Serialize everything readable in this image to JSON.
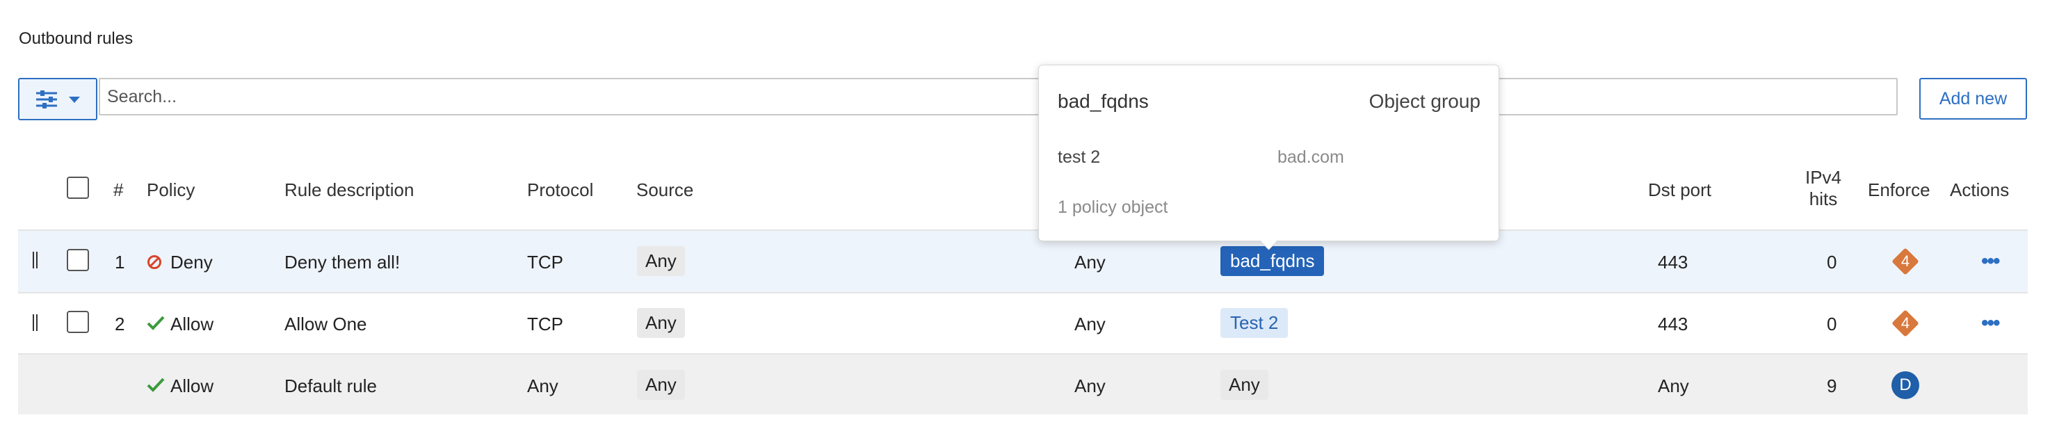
{
  "section_title": "Outbound rules",
  "toolbar": {
    "filter_icon": "sliders-icon",
    "search_placeholder": "Search...",
    "add_new_label": "Add new"
  },
  "table": {
    "headers": {
      "number": "#",
      "policy": "Policy",
      "description": "Rule description",
      "protocol": "Protocol",
      "source": "Source",
      "dst_port": "Dst port",
      "ipv4_hits_line1": "IPv4",
      "ipv4_hits_line2": "hits",
      "enforce": "Enforce",
      "actions": "Actions"
    },
    "rows": [
      {
        "number": "1",
        "policy": "Deny",
        "policy_icon": "deny-icon",
        "description": "Deny them all!",
        "protocol": "TCP",
        "source": "Any",
        "src_port": "Any",
        "destination": "bad_fqdns",
        "dst_port": "443",
        "ipv4_hits": "0",
        "enforce": "4"
      },
      {
        "number": "2",
        "policy": "Allow",
        "policy_icon": "check-icon",
        "description": "Allow One",
        "protocol": "TCP",
        "source": "Any",
        "src_port": "Any",
        "destination": "Test 2",
        "dst_port": "443",
        "ipv4_hits": "0",
        "enforce": "4"
      },
      {
        "policy": "Allow",
        "policy_icon": "check-icon",
        "description": "Default rule",
        "protocol": "Any",
        "source": "Any",
        "src_port": "Any",
        "destination": "Any",
        "dst_port": "Any",
        "ipv4_hits": "9",
        "enforce": "D"
      }
    ]
  },
  "popover": {
    "name": "bad_fqdns",
    "type": "Object group",
    "entry_name": "test 2",
    "entry_value": "bad.com",
    "footer": "1 policy object"
  },
  "colors": {
    "accent": "#2d6fc2",
    "deny": "#d9442b",
    "allow": "#3c9a3c",
    "enforce_diamond": "#d8783c",
    "enforce_default": "#1f5ea8",
    "selected_row": "#eef4fb",
    "default_row": "#f0f0f0"
  }
}
